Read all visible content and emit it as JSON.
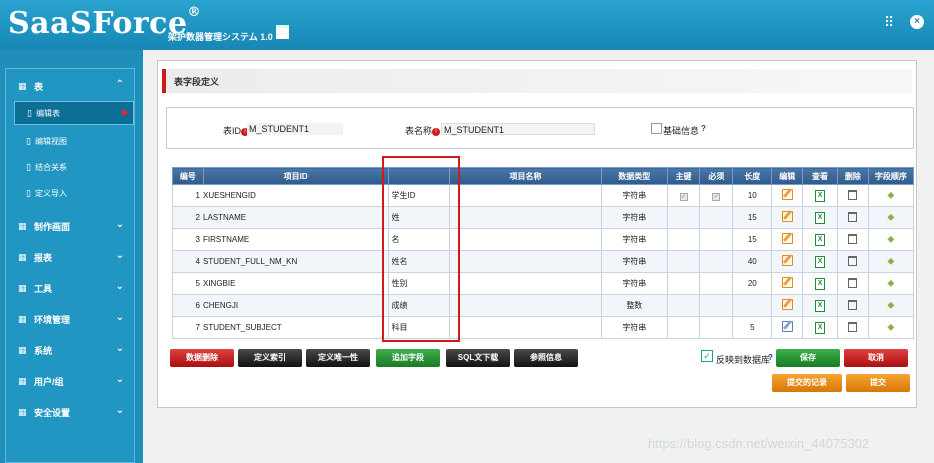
{
  "app": {
    "logo": "SaaSForce",
    "logo_mark": "®",
    "subtitle": "架护数器管理システム 1.0"
  },
  "sidebar": {
    "items": [
      {
        "label": "表",
        "icon": "grid-icon",
        "expanded": true
      },
      {
        "label": "制作画面",
        "icon": "grid-icon"
      },
      {
        "label": "报表",
        "icon": "grid-icon"
      },
      {
        "label": "工具",
        "icon": "grid-icon"
      },
      {
        "label": "环境管理",
        "icon": "grid-icon"
      },
      {
        "label": "系统",
        "icon": "grid-icon"
      },
      {
        "label": "用户/组",
        "icon": "grid-icon"
      },
      {
        "label": "安全设置",
        "icon": "grid-icon"
      }
    ],
    "sub_items": [
      {
        "label": "编辑表",
        "active": true
      },
      {
        "label": "编辑视图"
      },
      {
        "label": "结合关系"
      },
      {
        "label": "定义导入"
      }
    ]
  },
  "page": {
    "title": "表字段定义",
    "form": {
      "table_id_label": "表ID",
      "table_id_value": "M_STUDENT1",
      "table_name_label": "表名称",
      "table_name_value": "M_STUDENT1",
      "basic_info_label": "基础信息",
      "help": "?"
    },
    "table": {
      "headers": [
        "编号",
        "项目ID",
        "",
        "项目名称",
        "数据类型",
        "主键",
        "必须",
        "长度",
        "编辑",
        "查看",
        "删除",
        "字段顺序"
      ],
      "rows": [
        {
          "no": "1",
          "id": "XUESHENGID",
          "name": "学生ID",
          "type": "字符串",
          "pk": true,
          "required": true,
          "length": "10"
        },
        {
          "no": "2",
          "id": "LASTNAME",
          "name": "姓",
          "type": "字符串",
          "pk": false,
          "required": false,
          "length": "15"
        },
        {
          "no": "3",
          "id": "FIRSTNAME",
          "name": "名",
          "type": "字符串",
          "pk": false,
          "required": false,
          "length": "15"
        },
        {
          "no": "4",
          "id": "STUDENT_FULL_NM_KN",
          "name": "姓名",
          "type": "字符串",
          "pk": false,
          "required": false,
          "length": "40"
        },
        {
          "no": "5",
          "id": "XINGBIE",
          "name": "性别",
          "type": "字符串",
          "pk": false,
          "required": false,
          "length": "20"
        },
        {
          "no": "6",
          "id": "CHENGJI",
          "name": "成绩",
          "type": "整数",
          "pk": false,
          "required": false,
          "length": ""
        },
        {
          "no": "7",
          "id": "STUDENT_SUBJECT",
          "name": "科目",
          "type": "字符串",
          "pk": false,
          "required": false,
          "length": "5"
        }
      ]
    },
    "buttons": {
      "delete_data": "数据删除",
      "define_index": "定义索引",
      "define_unique": "定义唯一性",
      "add_field": "追加字段",
      "sql_download": "SQL文下载",
      "reference_info": "参照信息",
      "sync_label": "反映到数据库",
      "sync_help": "?",
      "save": "保存",
      "cancel": "取消",
      "submit_record": "提交的记录",
      "submit": "提交"
    }
  },
  "watermark": "https://blog.csdn.net/weixin_44075302",
  "colors": {
    "brand": "#1f8fb8",
    "accent_red": "#d01a1a",
    "table_header": "#3b67a0",
    "save_green": "#1f8f2e",
    "submit_orange": "#e98a14"
  }
}
